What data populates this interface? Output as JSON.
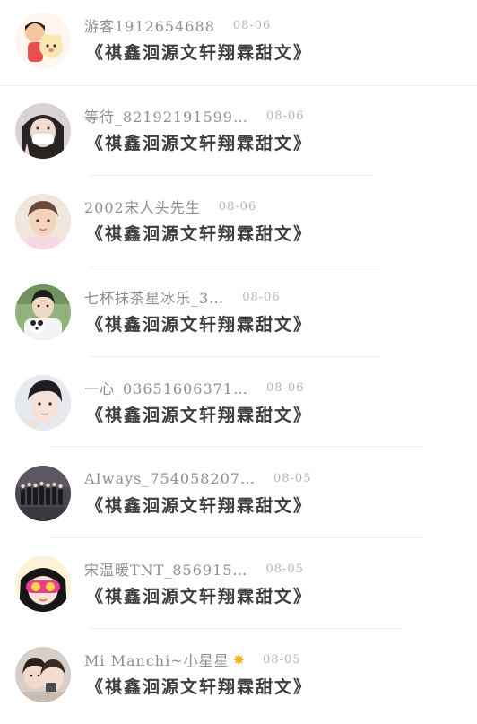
{
  "comments": [
    {
      "username": "游客1912654688",
      "date": "08-06",
      "text": "《祺鑫洄源文轩翔霖甜文》",
      "avatar": "cartoon-couple-avatar"
    },
    {
      "username": "等待_82192191599…",
      "date": "08-06",
      "text": "《祺鑫洄源文轩翔霖甜文》",
      "avatar": "masked-girl-avatar"
    },
    {
      "username": "2002宋人头先生",
      "date": "08-06",
      "text": "《祺鑫洄源文轩翔霖甜文》",
      "avatar": "boy-portrait-avatar"
    },
    {
      "username": "七杯抹茶星冰乐_3…",
      "date": "08-06",
      "text": "《祺鑫洄源文轩翔霖甜文》",
      "avatar": "boy-with-dog-avatar"
    },
    {
      "username": "一心_03651606371…",
      "date": "08-06",
      "text": "《祺鑫洄源文轩翔霖甜文》",
      "avatar": "boy-closeup-avatar"
    },
    {
      "username": "AIways_754058207…",
      "date": "08-05",
      "text": "《祺鑫洄源文轩翔霖甜文》",
      "avatar": "group-photo-avatar"
    },
    {
      "username": "宋温暖TNT_856915…",
      "date": "08-05",
      "text": "《祺鑫洄源文轩翔霖甜文》",
      "avatar": "cartoon-girl-avatar"
    },
    {
      "username": "Mi Manchi~小星星",
      "date": "08-05",
      "text": "《祺鑫洄源文轩翔霖甜文》",
      "avatar": "couple-photo-avatar",
      "badge": "star-icon"
    }
  ]
}
